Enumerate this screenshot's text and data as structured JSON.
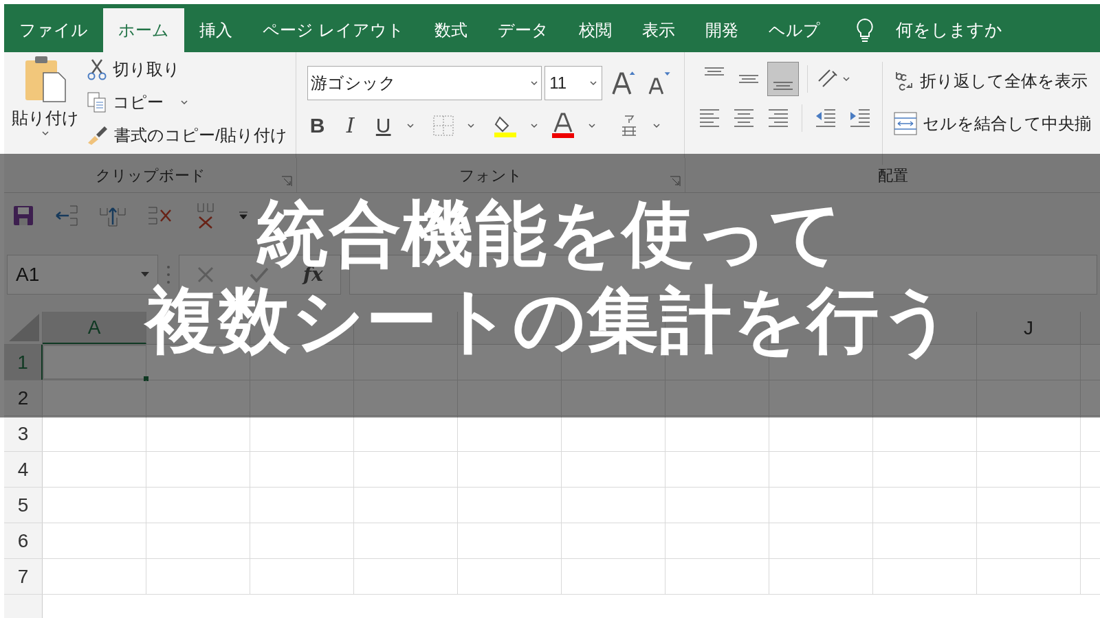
{
  "menu_tabs": [
    {
      "label": "ファイル",
      "selected": false
    },
    {
      "label": "ホーム",
      "selected": true
    },
    {
      "label": "挿入",
      "selected": false
    },
    {
      "label": "ページ レイアウト",
      "selected": false
    },
    {
      "label": "数式",
      "selected": false
    },
    {
      "label": "データ",
      "selected": false
    },
    {
      "label": "校閲",
      "selected": false
    },
    {
      "label": "表示",
      "selected": false
    },
    {
      "label": "開発",
      "selected": false
    },
    {
      "label": "ヘルプ",
      "selected": false
    }
  ],
  "tell_me": {
    "placeholder": "何をしますか"
  },
  "clipboard": {
    "paste": "貼り付け",
    "cut": "切り取り",
    "copy": "コピー",
    "format_painter": "書式のコピー/貼り付け",
    "group_label": "クリップボード"
  },
  "font": {
    "name": "游ゴシック",
    "size": "11",
    "bold": "B",
    "italic": "I",
    "underline": "U",
    "group_label": "フォント"
  },
  "alignment": {
    "vertical": [
      {
        "kind": "top",
        "selected": false
      },
      {
        "kind": "middle",
        "selected": false
      },
      {
        "kind": "bottom",
        "selected": true
      }
    ],
    "wrap_text": "折り返して全体を表示",
    "merge": "セルを結合して中央揃",
    "group_label": "配置"
  },
  "name_box": {
    "value": "A1"
  },
  "formula_bar": {
    "fx": "fx"
  },
  "columns": [
    {
      "label": "A",
      "selected": true
    },
    {
      "selected": false
    },
    {
      "selected": false
    },
    {
      "selected": false
    },
    {
      "selected": false
    },
    {
      "selected": false
    },
    {
      "selected": false
    },
    {
      "selected": false
    },
    {
      "selected": false
    },
    {
      "label": "J",
      "selected": false
    }
  ],
  "rows": [
    {
      "label": "1",
      "selected": true
    },
    {
      "label": "2",
      "selected": false
    },
    {
      "label": "3",
      "selected": false
    },
    {
      "label": "4",
      "selected": false
    },
    {
      "label": "5",
      "selected": false
    },
    {
      "label": "6",
      "selected": false
    },
    {
      "label": "7",
      "selected": false
    }
  ],
  "banner": {
    "lines": [
      "統合機能を使って",
      "複数シートの集計を行う"
    ]
  }
}
